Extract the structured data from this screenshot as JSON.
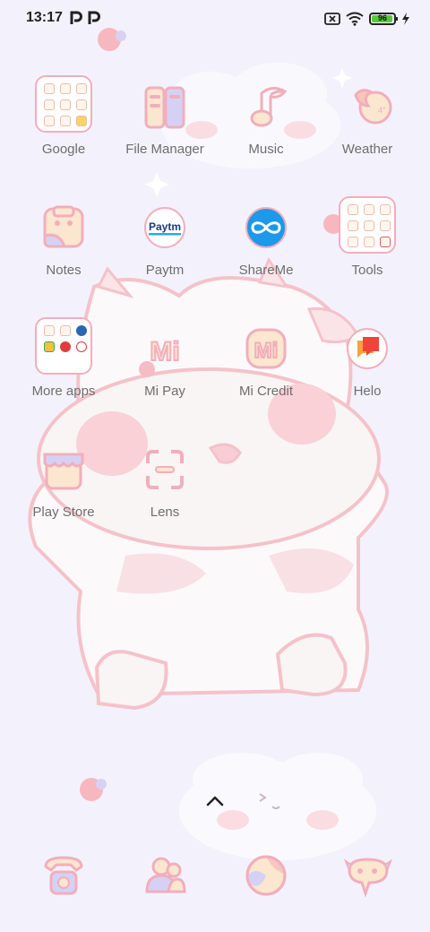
{
  "status_bar": {
    "time": "13:17",
    "battery_level": "96",
    "notification_icons": [
      "p-icon",
      "p-icon"
    ],
    "system_icons": [
      "no-sim-icon",
      "wifi-icon",
      "battery-icon",
      "charging-icon"
    ]
  },
  "apps": [
    {
      "label": "Google",
      "icon": "folder"
    },
    {
      "label": "File Manager",
      "icon": "file-manager-icon"
    },
    {
      "label": "Music",
      "icon": "music-icon"
    },
    {
      "label": "Weather",
      "icon": "weather-icon"
    },
    {
      "label": "Notes",
      "icon": "notes-icon"
    },
    {
      "label": "Paytm",
      "icon": "paytm-icon",
      "icon_text": "Paytm"
    },
    {
      "label": "ShareMe",
      "icon": "shareme-icon"
    },
    {
      "label": "Tools",
      "icon": "folder"
    },
    {
      "label": "More apps",
      "icon": "folder"
    },
    {
      "label": "Mi Pay",
      "icon": "mi-pay-icon",
      "icon_text": "Mi"
    },
    {
      "label": "Mi Credit",
      "icon": "mi-credit-icon",
      "icon_text": "Mi"
    },
    {
      "label": "Helo",
      "icon": "helo-icon"
    },
    {
      "label": "Play Store",
      "icon": "play-store-icon"
    },
    {
      "label": "Lens",
      "icon": "lens-icon"
    }
  ],
  "dock": [
    {
      "icon": "phone-icon"
    },
    {
      "icon": "contacts-icon"
    },
    {
      "icon": "browser-icon"
    },
    {
      "icon": "messages-icon"
    }
  ],
  "colors": {
    "background": "#f3f2fc",
    "icon_outline": "#f2aebb",
    "icon_fill": "#fbe6cf",
    "accent_purple": "#c9c4f2",
    "label_text": "#6e6e6e",
    "battery_green": "#55c93a",
    "shareme_blue": "#1e98e8",
    "helo_red": "#f0443a",
    "paytm_navy": "#1a3b78"
  }
}
